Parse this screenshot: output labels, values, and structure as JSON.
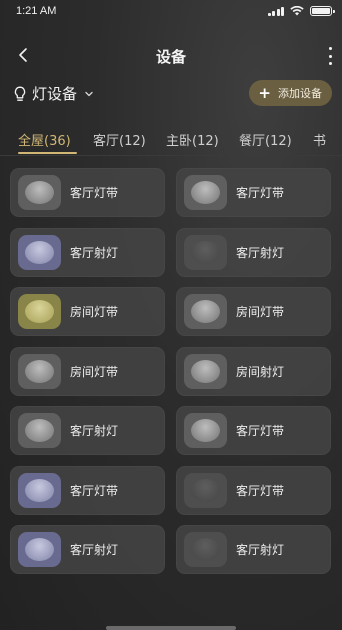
{
  "status_bar": {
    "time": "1:21 AM",
    "battery_level": 1.0
  },
  "nav": {
    "title": "设备"
  },
  "category": {
    "label": "灯设备"
  },
  "add_button": {
    "label": "添加设备",
    "color": "#6b5f42"
  },
  "tabs": [
    {
      "label": "全屋(36)",
      "active": true
    },
    {
      "label": "客厅(12)",
      "active": false
    },
    {
      "label": "主卧(12)",
      "active": false
    },
    {
      "label": "餐厅(12)",
      "active": false
    },
    {
      "label": "书",
      "active": false
    }
  ],
  "devices": [
    {
      "name": "客厅灯带",
      "lamp": "light"
    },
    {
      "name": "客厅灯带",
      "lamp": "light"
    },
    {
      "name": "客厅射灯",
      "lamp": "purple"
    },
    {
      "name": "客厅射灯",
      "lamp": "off"
    },
    {
      "name": "房间灯带",
      "lamp": "yellow"
    },
    {
      "name": "房间灯带",
      "lamp": "light"
    },
    {
      "name": "房间灯带",
      "lamp": "light"
    },
    {
      "name": "房间射灯",
      "lamp": "light"
    },
    {
      "name": "客厅射灯",
      "lamp": "light"
    },
    {
      "name": "客厅灯带",
      "lamp": "light"
    },
    {
      "name": "客厅灯带",
      "lamp": "purple"
    },
    {
      "name": "客厅灯带",
      "lamp": "off"
    },
    {
      "name": "客厅射灯",
      "lamp": "purple"
    },
    {
      "name": "客厅射灯",
      "lamp": "off"
    }
  ],
  "colors": {
    "accent": "#d1b776",
    "background": "#2c2c2c",
    "card": "#444444"
  }
}
